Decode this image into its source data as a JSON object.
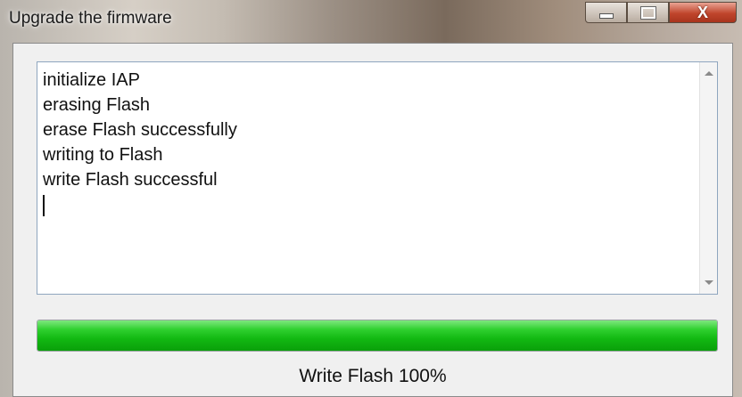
{
  "window": {
    "title": "Upgrade the firmware",
    "controls": [
      "minimize-icon",
      "maximize-icon",
      "close-icon"
    ],
    "close_glyph": "X"
  },
  "log": {
    "lines": [
      "initialize IAP",
      "erasing Flash",
      "erase Flash successfully",
      "writing to Flash",
      "write Flash successful"
    ]
  },
  "progress": {
    "percent": 100,
    "fill_color": "#12b912"
  },
  "status": {
    "text": "Write Flash  100%"
  }
}
